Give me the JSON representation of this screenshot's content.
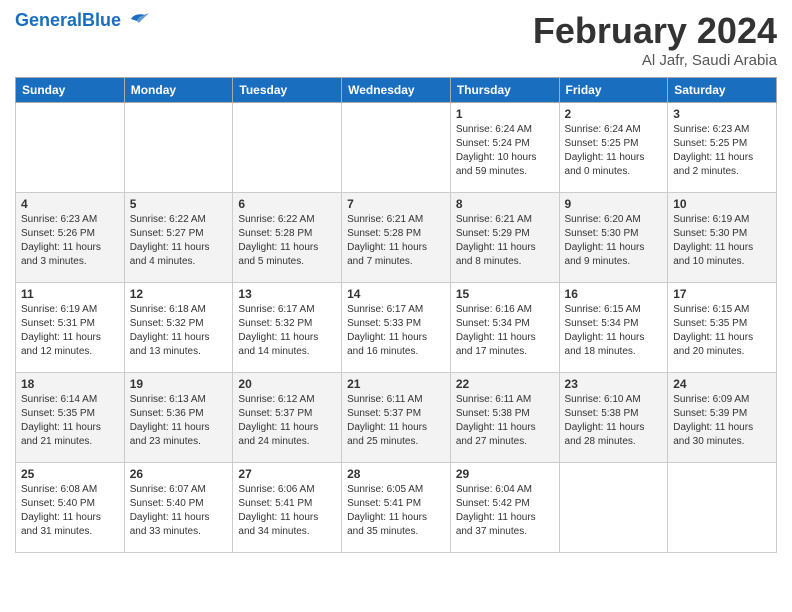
{
  "header": {
    "logo_general": "General",
    "logo_blue": "Blue",
    "month_year": "February 2024",
    "location": "Al Jafr, Saudi Arabia"
  },
  "weekdays": [
    "Sunday",
    "Monday",
    "Tuesday",
    "Wednesday",
    "Thursday",
    "Friday",
    "Saturday"
  ],
  "weeks": [
    [
      {
        "day": "",
        "info": ""
      },
      {
        "day": "",
        "info": ""
      },
      {
        "day": "",
        "info": ""
      },
      {
        "day": "",
        "info": ""
      },
      {
        "day": "1",
        "info": "Sunrise: 6:24 AM\nSunset: 5:24 PM\nDaylight: 10 hours and 59 minutes."
      },
      {
        "day": "2",
        "info": "Sunrise: 6:24 AM\nSunset: 5:25 PM\nDaylight: 11 hours and 0 minutes."
      },
      {
        "day": "3",
        "info": "Sunrise: 6:23 AM\nSunset: 5:25 PM\nDaylight: 11 hours and 2 minutes."
      }
    ],
    [
      {
        "day": "4",
        "info": "Sunrise: 6:23 AM\nSunset: 5:26 PM\nDaylight: 11 hours and 3 minutes."
      },
      {
        "day": "5",
        "info": "Sunrise: 6:22 AM\nSunset: 5:27 PM\nDaylight: 11 hours and 4 minutes."
      },
      {
        "day": "6",
        "info": "Sunrise: 6:22 AM\nSunset: 5:28 PM\nDaylight: 11 hours and 5 minutes."
      },
      {
        "day": "7",
        "info": "Sunrise: 6:21 AM\nSunset: 5:28 PM\nDaylight: 11 hours and 7 minutes."
      },
      {
        "day": "8",
        "info": "Sunrise: 6:21 AM\nSunset: 5:29 PM\nDaylight: 11 hours and 8 minutes."
      },
      {
        "day": "9",
        "info": "Sunrise: 6:20 AM\nSunset: 5:30 PM\nDaylight: 11 hours and 9 minutes."
      },
      {
        "day": "10",
        "info": "Sunrise: 6:19 AM\nSunset: 5:30 PM\nDaylight: 11 hours and 10 minutes."
      }
    ],
    [
      {
        "day": "11",
        "info": "Sunrise: 6:19 AM\nSunset: 5:31 PM\nDaylight: 11 hours and 12 minutes."
      },
      {
        "day": "12",
        "info": "Sunrise: 6:18 AM\nSunset: 5:32 PM\nDaylight: 11 hours and 13 minutes."
      },
      {
        "day": "13",
        "info": "Sunrise: 6:17 AM\nSunset: 5:32 PM\nDaylight: 11 hours and 14 minutes."
      },
      {
        "day": "14",
        "info": "Sunrise: 6:17 AM\nSunset: 5:33 PM\nDaylight: 11 hours and 16 minutes."
      },
      {
        "day": "15",
        "info": "Sunrise: 6:16 AM\nSunset: 5:34 PM\nDaylight: 11 hours and 17 minutes."
      },
      {
        "day": "16",
        "info": "Sunrise: 6:15 AM\nSunset: 5:34 PM\nDaylight: 11 hours and 18 minutes."
      },
      {
        "day": "17",
        "info": "Sunrise: 6:15 AM\nSunset: 5:35 PM\nDaylight: 11 hours and 20 minutes."
      }
    ],
    [
      {
        "day": "18",
        "info": "Sunrise: 6:14 AM\nSunset: 5:35 PM\nDaylight: 11 hours and 21 minutes."
      },
      {
        "day": "19",
        "info": "Sunrise: 6:13 AM\nSunset: 5:36 PM\nDaylight: 11 hours and 23 minutes."
      },
      {
        "day": "20",
        "info": "Sunrise: 6:12 AM\nSunset: 5:37 PM\nDaylight: 11 hours and 24 minutes."
      },
      {
        "day": "21",
        "info": "Sunrise: 6:11 AM\nSunset: 5:37 PM\nDaylight: 11 hours and 25 minutes."
      },
      {
        "day": "22",
        "info": "Sunrise: 6:11 AM\nSunset: 5:38 PM\nDaylight: 11 hours and 27 minutes."
      },
      {
        "day": "23",
        "info": "Sunrise: 6:10 AM\nSunset: 5:38 PM\nDaylight: 11 hours and 28 minutes."
      },
      {
        "day": "24",
        "info": "Sunrise: 6:09 AM\nSunset: 5:39 PM\nDaylight: 11 hours and 30 minutes."
      }
    ],
    [
      {
        "day": "25",
        "info": "Sunrise: 6:08 AM\nSunset: 5:40 PM\nDaylight: 11 hours and 31 minutes."
      },
      {
        "day": "26",
        "info": "Sunrise: 6:07 AM\nSunset: 5:40 PM\nDaylight: 11 hours and 33 minutes."
      },
      {
        "day": "27",
        "info": "Sunrise: 6:06 AM\nSunset: 5:41 PM\nDaylight: 11 hours and 34 minutes."
      },
      {
        "day": "28",
        "info": "Sunrise: 6:05 AM\nSunset: 5:41 PM\nDaylight: 11 hours and 35 minutes."
      },
      {
        "day": "29",
        "info": "Sunrise: 6:04 AM\nSunset: 5:42 PM\nDaylight: 11 hours and 37 minutes."
      },
      {
        "day": "",
        "info": ""
      },
      {
        "day": "",
        "info": ""
      }
    ]
  ]
}
